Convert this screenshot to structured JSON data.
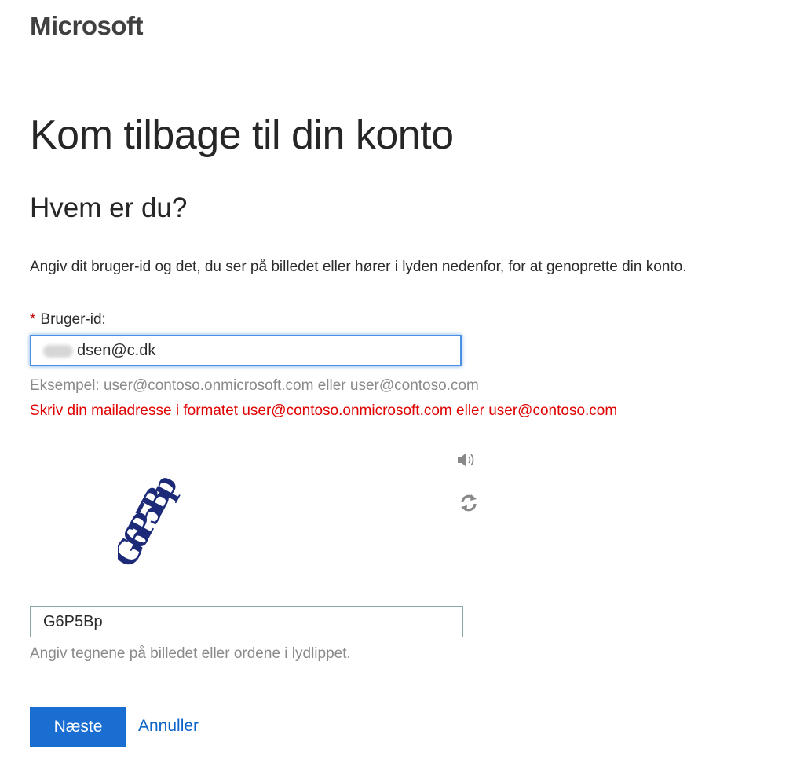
{
  "brand": {
    "logo_text": "Microsoft"
  },
  "page": {
    "title": "Kom tilbage til din konto",
    "subtitle": "Hvem er du?",
    "description": "Angiv dit bruger-id og det, du ser på billedet eller hører i lyden nedenfor, for at genoprette din konto."
  },
  "userid_field": {
    "required_marker": "*",
    "label": "Bruger-id:",
    "value": "dsen@c.dk",
    "example_hint": "Eksempel: user@contoso.onmicrosoft.com eller user@contoso.com",
    "error_message": "Skriv din mailadresse i formatet user@contoso.onmicrosoft.com eller user@contoso.com",
    "error_color": "#e00000",
    "focus_color": "#4a90e2"
  },
  "captcha": {
    "image_text": "G6P5Bp",
    "image_color": "#1c2a78",
    "audio_icon": "speaker-icon",
    "refresh_icon": "refresh-icon",
    "input_value": "G6P5Bp",
    "hint": "Angiv tegnene på billedet eller ordene i lydlippet."
  },
  "actions": {
    "next_label": "Næste",
    "cancel_label": "Annuller",
    "primary_color": "#1a6ed1",
    "link_color": "#0a64c8"
  }
}
